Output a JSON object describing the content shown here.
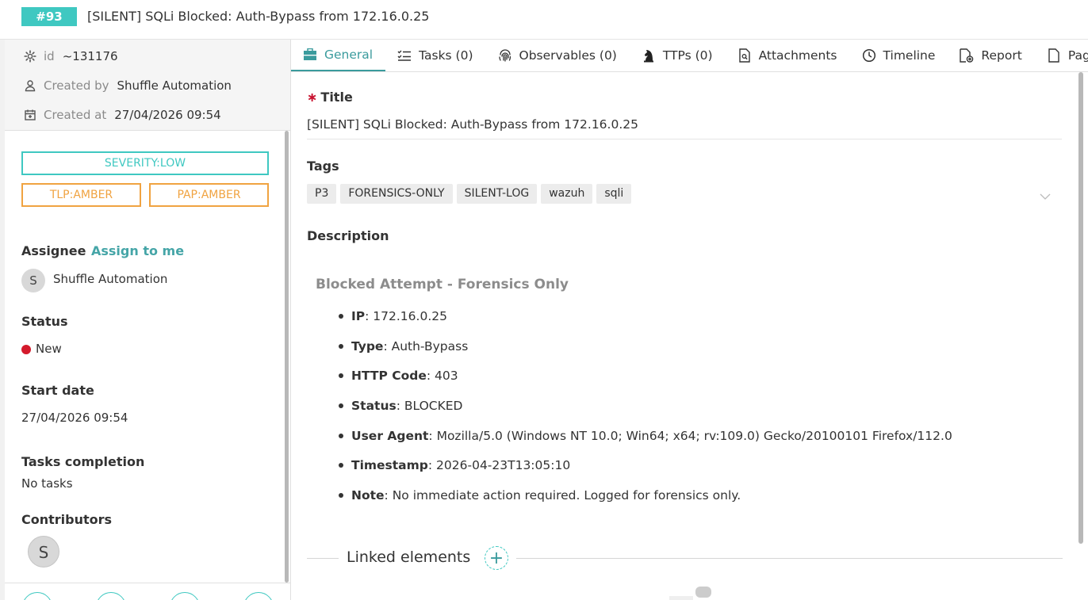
{
  "header": {
    "case_number": "#93",
    "title": "[SILENT] SQLi Blocked: Auth-Bypass from 172.16.0.25"
  },
  "sidebar": {
    "meta": {
      "id_label": "id",
      "id_value": "~131176",
      "created_by_label": "Created by",
      "created_by_value": "Shuffle Automation",
      "created_at_label": "Created at",
      "created_at_value": "27/04/2026 09:54"
    },
    "severity": "SEVERITY:LOW",
    "tlp": "TLP:AMBER",
    "pap": "PAP:AMBER",
    "assignee_label": "Assignee",
    "assign_to_me": "Assign to me",
    "assignee_initial": "S",
    "assignee_name": "Shuffle Automation",
    "status_label": "Status",
    "status_value": "New",
    "start_date_label": "Start date",
    "start_date_value": "27/04/2026 09:54",
    "tasks_completion_label": "Tasks completion",
    "tasks_completion_value": "No tasks",
    "contributors_label": "Contributors",
    "contributor_initial": "S"
  },
  "tabs": [
    {
      "label": "General",
      "icon": "case-icon",
      "active": true
    },
    {
      "label": "Tasks (0)",
      "icon": "tasks-icon"
    },
    {
      "label": "Observables (0)",
      "icon": "fingerprint-icon"
    },
    {
      "label": "TTPs (0)",
      "icon": "chess-knight-icon"
    },
    {
      "label": "Attachments",
      "icon": "file-search-icon"
    },
    {
      "label": "Timeline",
      "icon": "clock-icon"
    },
    {
      "label": "Report",
      "icon": "file-plus-icon"
    },
    {
      "label": "Pag",
      "icon": "page-icon"
    }
  ],
  "main": {
    "title_label": "Title",
    "title_value": "[SILENT] SQLi Blocked: Auth-Bypass from 172.16.0.25",
    "tags_label": "Tags",
    "tags": [
      "P3",
      "FORENSICS-ONLY",
      "SILENT-LOG",
      "wazuh",
      "sqli"
    ],
    "description_label": "Description",
    "description_heading": "Blocked Attempt - Forensics Only",
    "description_items": [
      {
        "key": "IP",
        "value": ": 172.16.0.25"
      },
      {
        "key": "Type",
        "value": ": Auth-Bypass"
      },
      {
        "key": "HTTP Code",
        "value": ": 403"
      },
      {
        "key": "Status",
        "value": ": BLOCKED"
      },
      {
        "key": "User Agent",
        "value": ": Mozilla/5.0 (Windows NT 10.0; Win64; x64; rv:109.0) Gecko/20100101 Firefox/112.0"
      },
      {
        "key": "Timestamp",
        "value": ": 2026-04-23T13:05:10"
      },
      {
        "key": "Note",
        "value": ": No immediate action required. Logged for forensics only."
      }
    ],
    "linked_elements_label": "Linked elements",
    "linked_add_symbol": "+"
  },
  "colors": {
    "accent": "#3fc8c1",
    "accent_dark": "#3a9b9d",
    "amber": "#f0a341",
    "status_new": "#d41a2c"
  }
}
